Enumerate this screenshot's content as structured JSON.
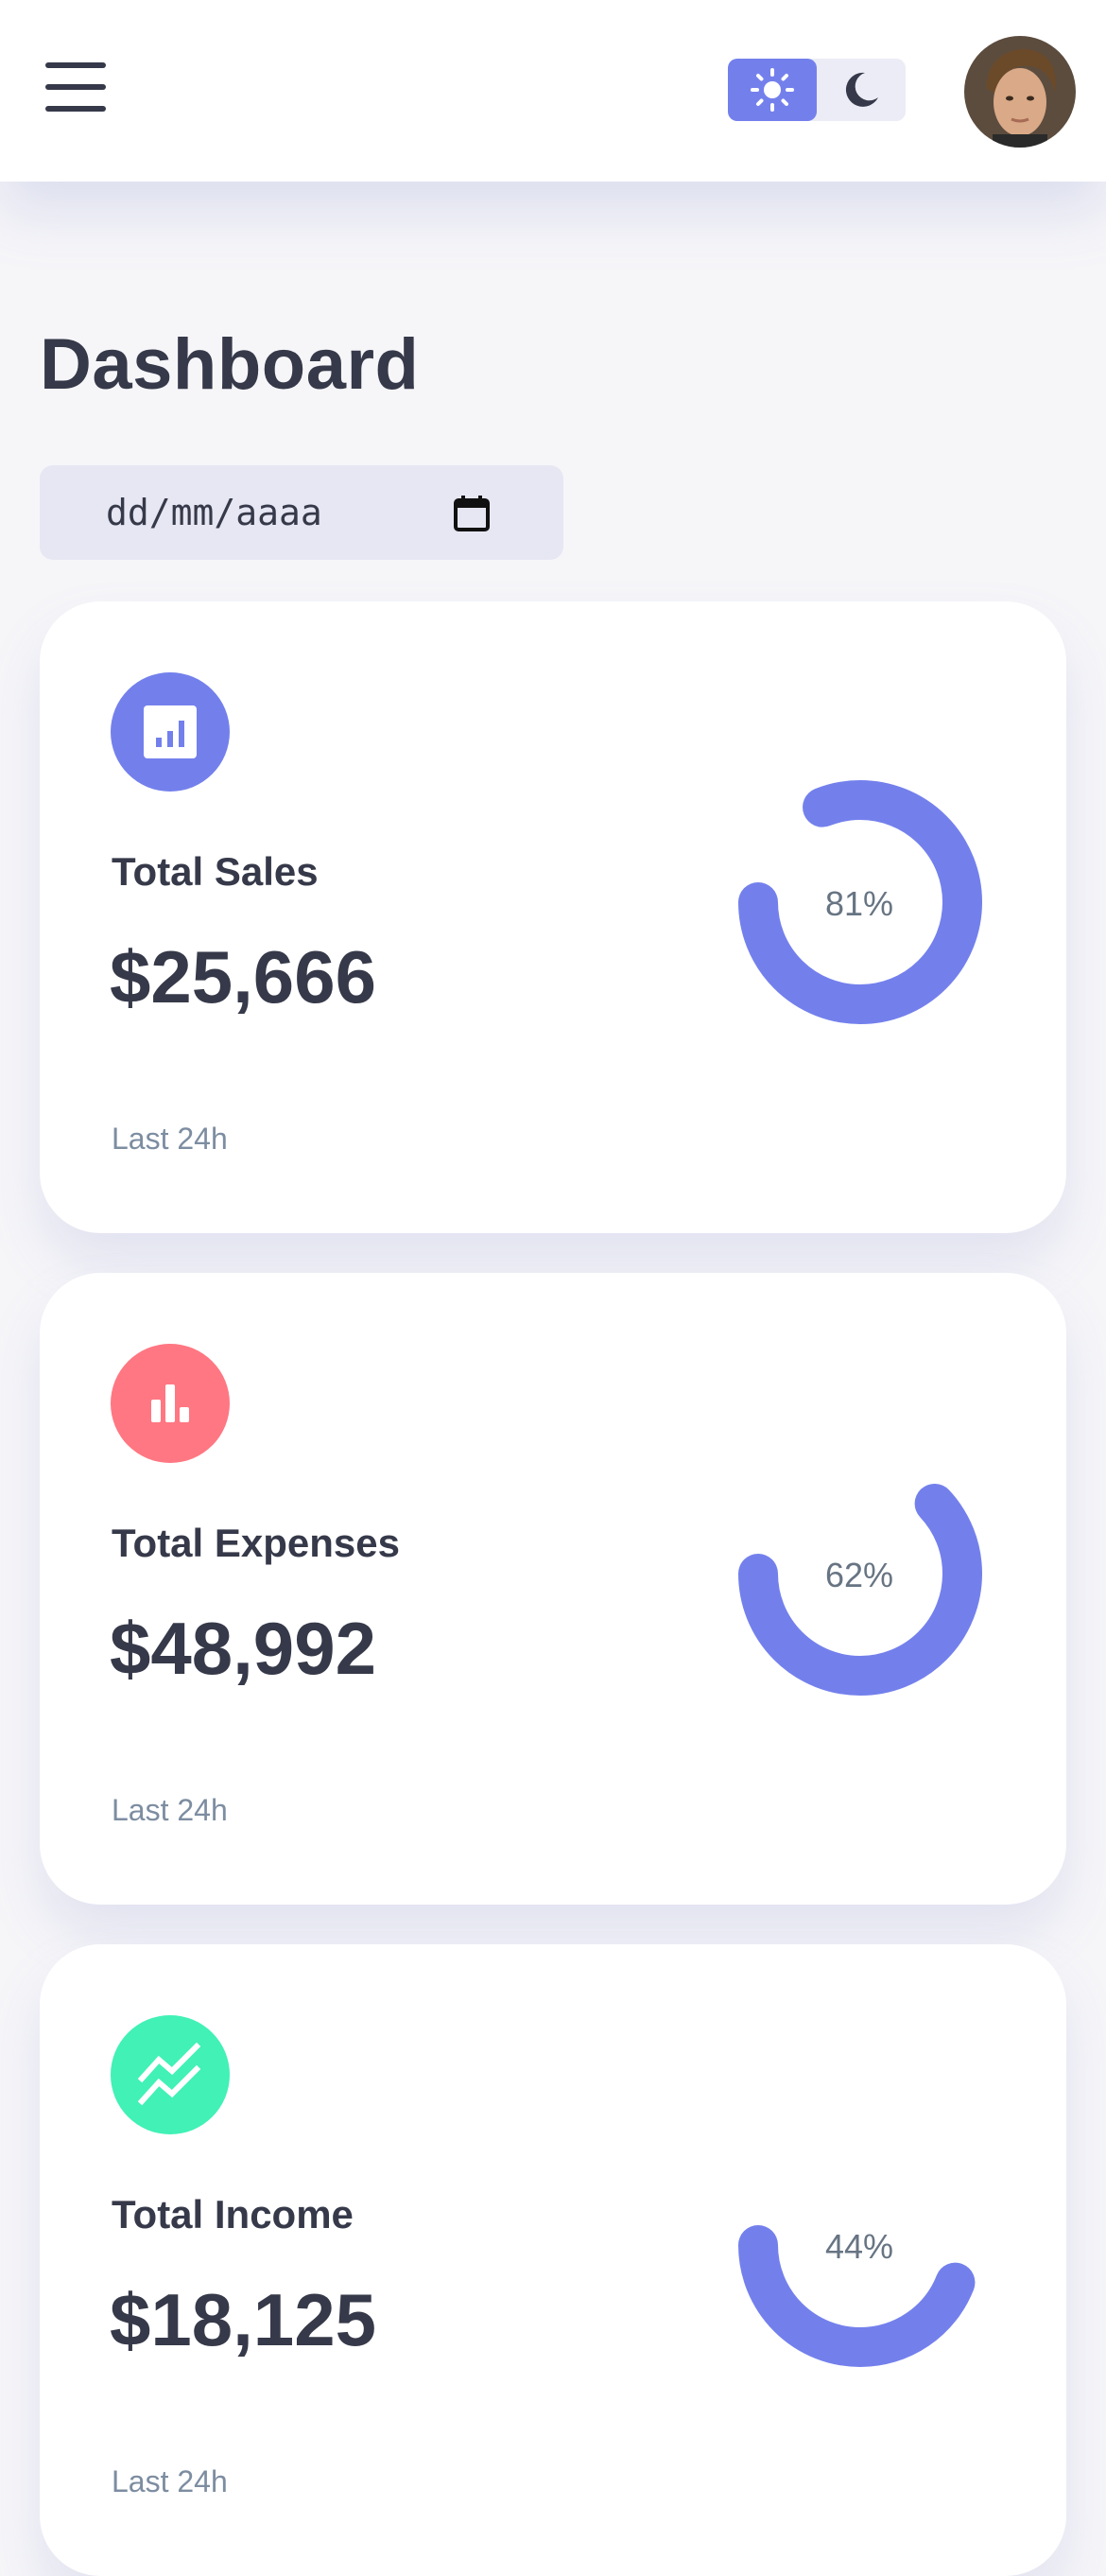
{
  "page": {
    "title": "Dashboard"
  },
  "date_filter": {
    "placeholder": "dd/mm/aaaa"
  },
  "colors": {
    "primary": "#7380ec",
    "danger": "#ff7782",
    "success": "#41f1b6",
    "dark": "#363949"
  },
  "theme": {
    "active": "light"
  },
  "cards": [
    {
      "label": "Total Sales",
      "amount": "$25,666",
      "meta": "Last 24h",
      "percent_label": "81%",
      "percent": 81,
      "icon": "analytics-icon",
      "icon_color": "#7380ec"
    },
    {
      "label": "Total Expenses",
      "amount": "$48,992",
      "meta": "Last 24h",
      "percent_label": "62%",
      "percent": 62,
      "icon": "bar-chart-icon",
      "icon_color": "#ff7782"
    },
    {
      "label": "Total Income",
      "amount": "$18,125",
      "meta": "Last 24h",
      "percent_label": "44%",
      "percent": 44,
      "icon": "stacked-line-chart-icon",
      "icon_color": "#41f1b6"
    }
  ]
}
